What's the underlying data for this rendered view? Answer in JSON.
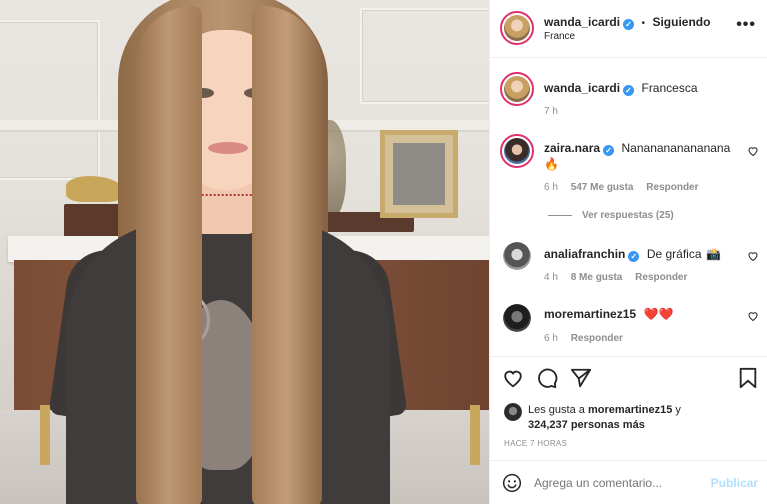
{
  "post": {
    "author": "wanda_icardi",
    "follow_status": "Siguiendo",
    "separator": "•",
    "location": "France"
  },
  "caption": {
    "username": "wanda_icardi",
    "text": "Francesca",
    "time": "7 h"
  },
  "comments": [
    {
      "username": "zaira.nara",
      "text": "Nananananananana",
      "emoji": "🔥",
      "time": "6 h",
      "likes": "547 Me gusta",
      "reply": "Responder",
      "view_replies": "Ver respuestas (25)"
    },
    {
      "username": "analiafranchin",
      "text": "De gráfica",
      "emoji": "📸",
      "time": "4 h",
      "likes": "8 Me gusta",
      "reply": "Responder"
    },
    {
      "username": "moremartinez15",
      "text": "",
      "emoji": "❤️❤️",
      "time": "6 h",
      "reply": "Responder"
    }
  ],
  "likes": {
    "prefix": "Les gusta a",
    "user": "moremartinez15",
    "connector": "y",
    "count": "324,237",
    "suffix": "personas más"
  },
  "timestamp": "HACE 7 HORAS",
  "comment_input": {
    "placeholder": "Agrega un comentario...",
    "publish": "Publicar"
  },
  "colors": {
    "verified": "#3897f0",
    "heart_red": "#ed4956",
    "publish_disabled": "#b2dffc",
    "story_ring": "#e1306c"
  },
  "icons": [
    "more-options-icon",
    "like-heart-icon",
    "comment-icon",
    "share-icon",
    "save-bookmark-icon",
    "emoji-icon",
    "verified-badge-icon"
  ]
}
